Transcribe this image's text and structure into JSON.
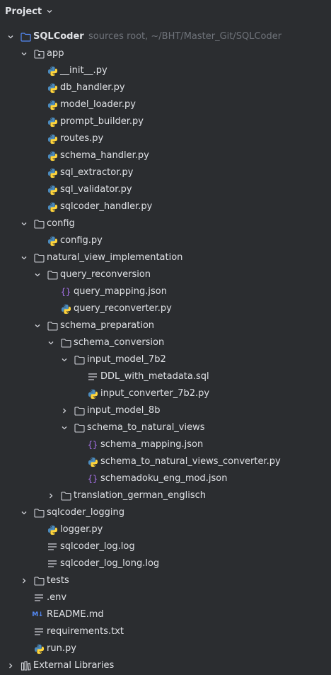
{
  "header": {
    "title": "Project"
  },
  "tree": [
    {
      "label": "SQLCoder",
      "hint": "sources root,  ~/BHT/Master_Git/SQLCoder",
      "type": "root",
      "depth": 0,
      "expanded": true
    },
    {
      "label": "app",
      "type": "package",
      "depth": 1,
      "expanded": true
    },
    {
      "label": "__init__.py",
      "type": "py",
      "depth": 2
    },
    {
      "label": "db_handler.py",
      "type": "py",
      "depth": 2
    },
    {
      "label": "model_loader.py",
      "type": "py",
      "depth": 2
    },
    {
      "label": "prompt_builder.py",
      "type": "py",
      "depth": 2
    },
    {
      "label": "routes.py",
      "type": "py",
      "depth": 2
    },
    {
      "label": "schema_handler.py",
      "type": "py",
      "depth": 2
    },
    {
      "label": "sql_extractor.py",
      "type": "py",
      "depth": 2
    },
    {
      "label": "sql_validator.py",
      "type": "py",
      "depth": 2
    },
    {
      "label": "sqlcoder_handler.py",
      "type": "py",
      "depth": 2
    },
    {
      "label": "config",
      "type": "folder",
      "depth": 1,
      "expanded": true
    },
    {
      "label": "config.py",
      "type": "py",
      "depth": 2
    },
    {
      "label": "natural_view_implementation",
      "type": "folder",
      "depth": 1,
      "expanded": true
    },
    {
      "label": "query_reconversion",
      "type": "folder",
      "depth": 2,
      "expanded": true
    },
    {
      "label": "query_mapping.json",
      "type": "json",
      "depth": 3
    },
    {
      "label": "query_reconverter.py",
      "type": "py",
      "depth": 3
    },
    {
      "label": "schema_preparation",
      "type": "folder",
      "depth": 2,
      "expanded": true
    },
    {
      "label": "schema_conversion",
      "type": "folder",
      "depth": 3,
      "expanded": true
    },
    {
      "label": "input_model_7b2",
      "type": "folder",
      "depth": 4,
      "expanded": true
    },
    {
      "label": "DDL_with_metadata.sql",
      "type": "text",
      "depth": 5
    },
    {
      "label": "input_converter_7b2.py",
      "type": "py",
      "depth": 5
    },
    {
      "label": "input_model_8b",
      "type": "folder",
      "depth": 4,
      "expanded": false
    },
    {
      "label": "schema_to_natural_views",
      "type": "folder",
      "depth": 4,
      "expanded": true
    },
    {
      "label": "schema_mapping.json",
      "type": "json",
      "depth": 5
    },
    {
      "label": "schema_to_natural_views_converter.py",
      "type": "py",
      "depth": 5
    },
    {
      "label": "schemadoku_eng_mod.json",
      "type": "json",
      "depth": 5
    },
    {
      "label": "translation_german_englisch",
      "type": "folder",
      "depth": 3,
      "expanded": false
    },
    {
      "label": "sqlcoder_logging",
      "type": "folder",
      "depth": 1,
      "expanded": true
    },
    {
      "label": "logger.py",
      "type": "py",
      "depth": 2
    },
    {
      "label": "sqlcoder_log.log",
      "type": "text",
      "depth": 2
    },
    {
      "label": "sqlcoder_log_long.log",
      "type": "text",
      "depth": 2
    },
    {
      "label": "tests",
      "type": "folder",
      "depth": 1,
      "expanded": false
    },
    {
      "label": ".env",
      "type": "text",
      "depth": 1
    },
    {
      "label": "README.md",
      "type": "md",
      "depth": 1
    },
    {
      "label": "requirements.txt",
      "type": "text",
      "depth": 1
    },
    {
      "label": "run.py",
      "type": "py",
      "depth": 1
    },
    {
      "label": "External Libraries",
      "type": "libs",
      "depth": 0,
      "expanded": false
    }
  ],
  "icons": {
    "py": "python-icon",
    "json": "json-icon",
    "text": "text-file-icon",
    "md": "markdown-icon",
    "folder": "folder-icon",
    "package": "package-folder-icon",
    "root": "module-folder-icon",
    "libs": "libraries-icon"
  },
  "colors": {
    "background": "#2b2d30",
    "text": "#dfe1e5",
    "hint": "#6f737a",
    "python_blue": "#4b8bbe",
    "python_yellow": "#ffd43b",
    "folder": "#ced0d6",
    "root_folder": "#548af7",
    "json": "#a571e6"
  }
}
